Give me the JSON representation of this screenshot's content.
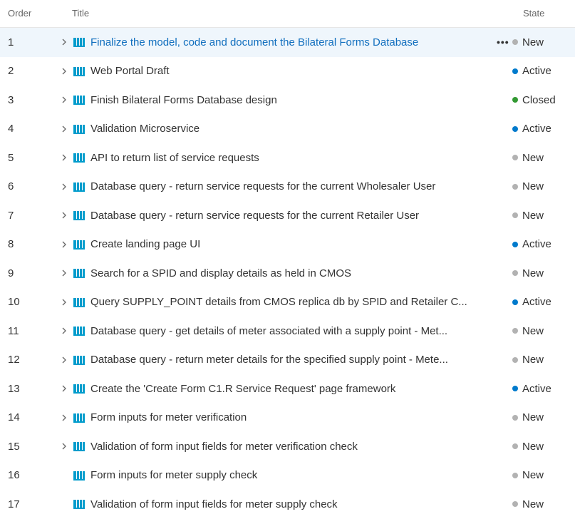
{
  "header": {
    "order": "Order",
    "title": "Title",
    "state": "State"
  },
  "colors": {
    "New": "#b2b2b2",
    "Active": "#007acc",
    "Closed": "#339933",
    "icon": "#009ccc",
    "selected_title": "#106ebe",
    "selected_row_bg": "#eff6fc"
  },
  "icons": {
    "expand": "chevron-right-icon",
    "work_item": "book-icon",
    "more": "more-actions-icon"
  },
  "more_label": "•••",
  "rows": [
    {
      "order": "1",
      "title": "Finalize the model, code and document the Bilateral Forms Database",
      "state": "New",
      "expandable": true,
      "selected": true
    },
    {
      "order": "2",
      "title": "Web Portal Draft",
      "state": "Active",
      "expandable": true
    },
    {
      "order": "3",
      "title": "Finish Bilateral Forms Database design",
      "state": "Closed",
      "expandable": true
    },
    {
      "order": "4",
      "title": "Validation Microservice",
      "state": "Active",
      "expandable": true
    },
    {
      "order": "5",
      "title": "API to return list of service requests",
      "state": "New",
      "expandable": true
    },
    {
      "order": "6",
      "title": "Database query - return service requests for the current Wholesaler User",
      "state": "New",
      "expandable": true
    },
    {
      "order": "7",
      "title": "Database query - return service requests for the current Retailer User",
      "state": "New",
      "expandable": true
    },
    {
      "order": "8",
      "title": "Create landing page UI",
      "state": "Active",
      "expandable": true
    },
    {
      "order": "9",
      "title": "Search for a SPID and display details as held in CMOS",
      "state": "New",
      "expandable": true
    },
    {
      "order": "10",
      "title": "Query SUPPLY_POINT details from CMOS replica db by SPID and Retailer C...",
      "state": "Active",
      "expandable": true
    },
    {
      "order": "11",
      "title": "Database query - get details of meter associated with a supply point - Met...",
      "state": "New",
      "expandable": true
    },
    {
      "order": "12",
      "title": "Database query - return meter details for the specified supply point - Mete...",
      "state": "New",
      "expandable": true
    },
    {
      "order": "13",
      "title": "Create the 'Create Form C1.R Service Request' page framework",
      "state": "Active",
      "expandable": true
    },
    {
      "order": "14",
      "title": "Form inputs for meter verification",
      "state": "New",
      "expandable": true
    },
    {
      "order": "15",
      "title": "Validation of form input fields for meter verification check",
      "state": "New",
      "expandable": true
    },
    {
      "order": "16",
      "title": "Form inputs for meter supply check",
      "state": "New",
      "expandable": false
    },
    {
      "order": "17",
      "title": "Validation of form input fields for meter supply check",
      "state": "New",
      "expandable": false
    }
  ]
}
